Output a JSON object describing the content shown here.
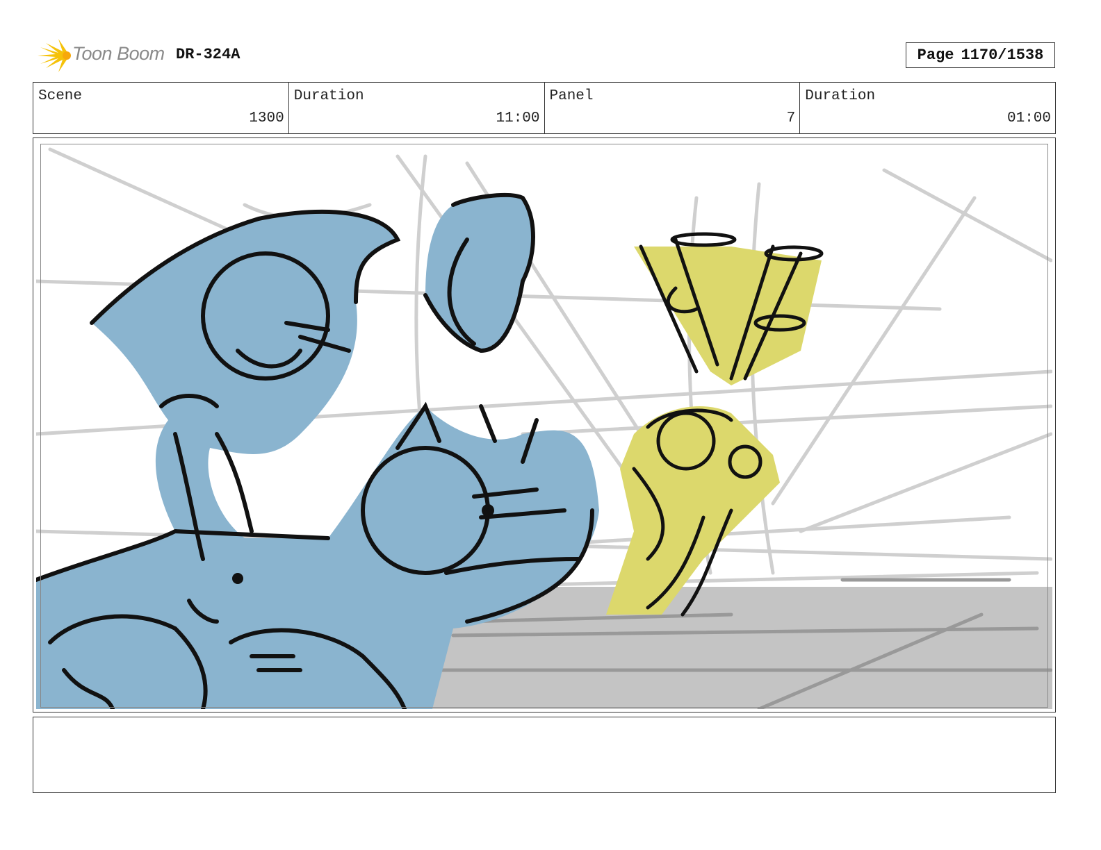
{
  "header": {
    "brand": "Toon Boom",
    "project_code": "DR-324A",
    "page_label": "Page",
    "page_value": "1170/1538"
  },
  "info": {
    "scene_label": "Scene",
    "scene_value": "1300",
    "scene_duration_label": "Duration",
    "scene_duration_value": "11:00",
    "panel_label": "Panel",
    "panel_value": "7",
    "panel_duration_label": "Duration",
    "panel_duration_value": "01:00"
  },
  "notes": {
    "text": ""
  },
  "colors": {
    "character_blue": "#8ab4cf",
    "character_yellow": "#dcd86c",
    "background_gray": "#c4c4c4",
    "sketch_line": "#111111",
    "logo_yellow": "#f5c20a"
  }
}
